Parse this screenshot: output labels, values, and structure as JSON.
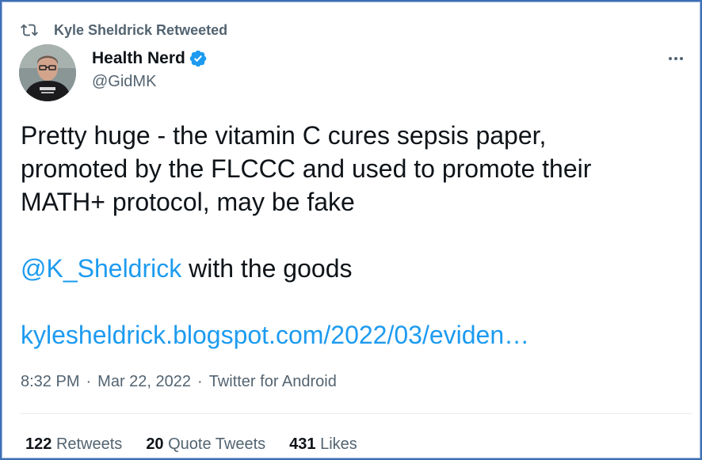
{
  "retweet_context": {
    "label": "Kyle Sheldrick Retweeted",
    "icon": "retweet-icon"
  },
  "author": {
    "display_name": "Health Nerd",
    "handle": "@GidMK",
    "verified": true,
    "verified_icon": "verified-badge-icon",
    "avatar": "avatar"
  },
  "tweet": {
    "line1": "Pretty huge - the vitamin C cures sepsis paper,",
    "line2": "promoted by the FLCCC and used to promote their",
    "line3": "MATH+ protocol, may be fake",
    "mention": "@K_Sheldrick",
    "mention_suffix": " with the goods",
    "link": "kylesheldrick.blogspot.com/2022/03/eviden…"
  },
  "meta": {
    "time": "8:32 PM",
    "separator": "·",
    "date": "Mar 22, 2022",
    "source": "Twitter for Android"
  },
  "stats": {
    "retweets_count": "122",
    "retweets_label": "Retweets",
    "quotes_count": "20",
    "quotes_label": "Quote Tweets",
    "likes_count": "431",
    "likes_label": "Likes"
  },
  "colors": {
    "link": "#1d9bf0",
    "secondary_text": "#536471",
    "primary_text": "#0f1419",
    "verified": "#1d9bf0",
    "frame_border": "#3d6fb4"
  },
  "more_menu_icon": "more-icon"
}
